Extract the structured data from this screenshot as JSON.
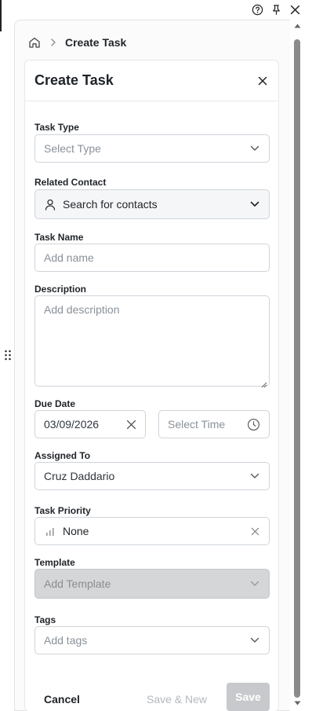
{
  "window": {
    "help_icon": "help-circle-icon",
    "pin_icon": "pin-icon",
    "close_icon": "close-icon"
  },
  "breadcrumb": {
    "home_icon": "home-icon",
    "separator_icon": "chevron-right-icon",
    "current": "Create Task"
  },
  "card": {
    "title": "Create Task",
    "close_icon": "close-icon"
  },
  "form": {
    "task_type": {
      "label": "Task Type",
      "placeholder": "Select Type"
    },
    "related_contact": {
      "label": "Related Contact",
      "placeholder": "Search for contacts"
    },
    "task_name": {
      "label": "Task Name",
      "placeholder": "Add name"
    },
    "description": {
      "label": "Description",
      "placeholder": "Add description"
    },
    "due_date": {
      "label": "Due Date",
      "date_value": "03/09/2026",
      "time_placeholder": "Select Time"
    },
    "assigned_to": {
      "label": "Assigned To",
      "value": "Cruz Daddario"
    },
    "task_priority": {
      "label": "Task Priority",
      "value": "None"
    },
    "template": {
      "label": "Template",
      "placeholder": "Add Template"
    },
    "tags": {
      "label": "Tags",
      "placeholder": "Add tags"
    }
  },
  "footer": {
    "cancel": "Cancel",
    "save_new": "Save & New",
    "save": "Save"
  },
  "colors": {
    "border": "#cfd4da",
    "disabled_bg": "#d5d6d7",
    "save_disabled": "#c7c9cc",
    "scroll_thumb": "#8b8b8b"
  }
}
